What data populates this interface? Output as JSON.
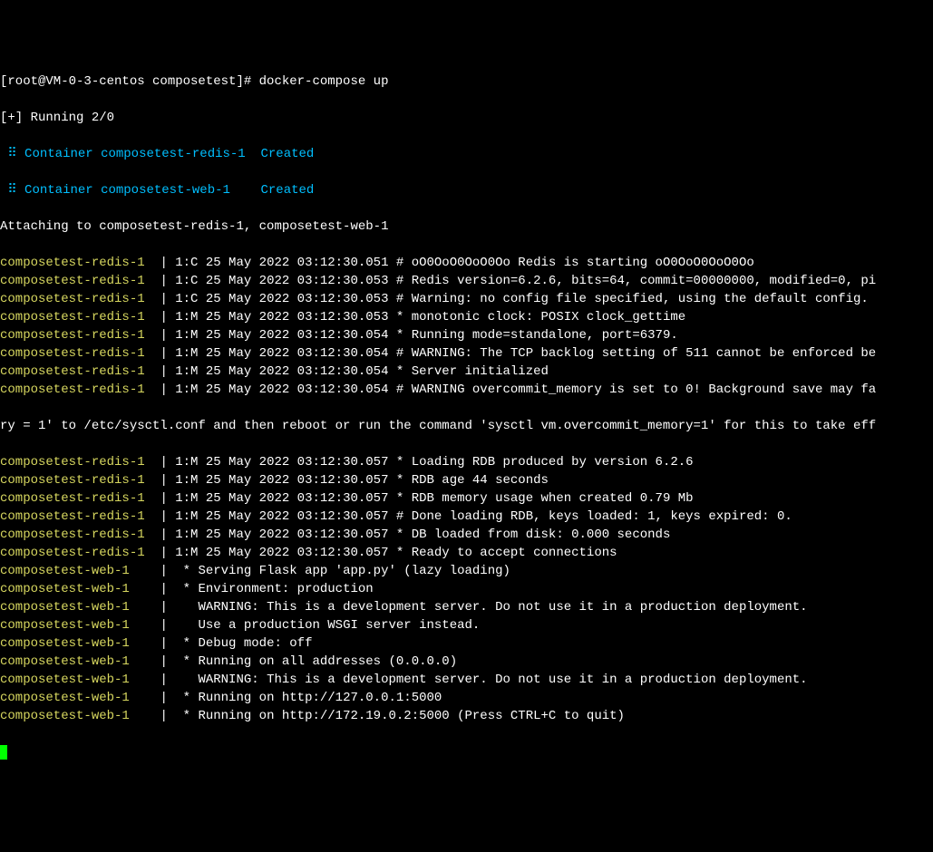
{
  "prompt": "[root@VM-0-3-centos composetest]# docker-compose up",
  "running": "[+] Running 2/0",
  "container1_prefix": " ⠿ Container composetest-redis-1  ",
  "container1_status": "Created",
  "container2_prefix": " ⠿ Container composetest-web-1    ",
  "container2_status": "Created",
  "attaching": "Attaching to composetest-redis-1, composetest-web-1",
  "lines": [
    {
      "svc": "composetest-redis-1  ",
      "sep": "| ",
      "msg": "1:C 25 May 2022 03:12:30.051 # oO0OoO0OoO0Oo Redis is starting oO0OoO0OoO0Oo"
    },
    {
      "svc": "composetest-redis-1  ",
      "sep": "| ",
      "msg": "1:C 25 May 2022 03:12:30.053 # Redis version=6.2.6, bits=64, commit=00000000, modified=0, pi"
    },
    {
      "svc": "composetest-redis-1  ",
      "sep": "| ",
      "msg": "1:C 25 May 2022 03:12:30.053 # Warning: no config file specified, using the default config."
    },
    {
      "svc": "composetest-redis-1  ",
      "sep": "| ",
      "msg": "1:M 25 May 2022 03:12:30.053 * monotonic clock: POSIX clock_gettime"
    },
    {
      "svc": "composetest-redis-1  ",
      "sep": "| ",
      "msg": "1:M 25 May 2022 03:12:30.054 * Running mode=standalone, port=6379."
    },
    {
      "svc": "composetest-redis-1  ",
      "sep": "| ",
      "msg": "1:M 25 May 2022 03:12:30.054 # WARNING: The TCP backlog setting of 511 cannot be enforced be"
    },
    {
      "svc": "composetest-redis-1  ",
      "sep": "| ",
      "msg": "1:M 25 May 2022 03:12:30.054 * Server initialized"
    },
    {
      "svc": "composetest-redis-1  ",
      "sep": "| ",
      "msg": "1:M 25 May 2022 03:12:30.054 # WARNING overcommit_memory is set to 0! Background save may fa"
    }
  ],
  "wrap_line": "ry = 1' to /etc/sysctl.conf and then reboot or run the command 'sysctl vm.overcommit_memory=1' for this to take eff",
  "lines2": [
    {
      "svc": "composetest-redis-1  ",
      "sep": "| ",
      "msg": "1:M 25 May 2022 03:12:30.057 * Loading RDB produced by version 6.2.6"
    },
    {
      "svc": "composetest-redis-1  ",
      "sep": "| ",
      "msg": "1:M 25 May 2022 03:12:30.057 * RDB age 44 seconds"
    },
    {
      "svc": "composetest-redis-1  ",
      "sep": "| ",
      "msg": "1:M 25 May 2022 03:12:30.057 * RDB memory usage when created 0.79 Mb"
    },
    {
      "svc": "composetest-redis-1  ",
      "sep": "| ",
      "msg": "1:M 25 May 2022 03:12:30.057 # Done loading RDB, keys loaded: 1, keys expired: 0."
    },
    {
      "svc": "composetest-redis-1  ",
      "sep": "| ",
      "msg": "1:M 25 May 2022 03:12:30.057 * DB loaded from disk: 0.000 seconds"
    },
    {
      "svc": "composetest-redis-1  ",
      "sep": "| ",
      "msg": "1:M 25 May 2022 03:12:30.057 * Ready to accept connections"
    },
    {
      "svc": "composetest-web-1    ",
      "sep": "| ",
      "msg": " * Serving Flask app 'app.py' (lazy loading)"
    },
    {
      "svc": "composetest-web-1    ",
      "sep": "| ",
      "msg": " * Environment: production"
    },
    {
      "svc": "composetest-web-1    ",
      "sep": "| ",
      "msg": "   WARNING: This is a development server. Do not use it in a production deployment."
    },
    {
      "svc": "composetest-web-1    ",
      "sep": "| ",
      "msg": "   Use a production WSGI server instead."
    },
    {
      "svc": "composetest-web-1    ",
      "sep": "| ",
      "msg": " * Debug mode: off"
    },
    {
      "svc": "composetest-web-1    ",
      "sep": "| ",
      "msg": " * Running on all addresses (0.0.0.0)"
    },
    {
      "svc": "composetest-web-1    ",
      "sep": "| ",
      "msg": "   WARNING: This is a development server. Do not use it in a production deployment."
    },
    {
      "svc": "composetest-web-1    ",
      "sep": "| ",
      "msg": " * Running on http://127.0.0.1:5000"
    },
    {
      "svc": "composetest-web-1    ",
      "sep": "| ",
      "msg": " * Running on http://172.19.0.2:5000 (Press CTRL+C to quit)"
    }
  ]
}
